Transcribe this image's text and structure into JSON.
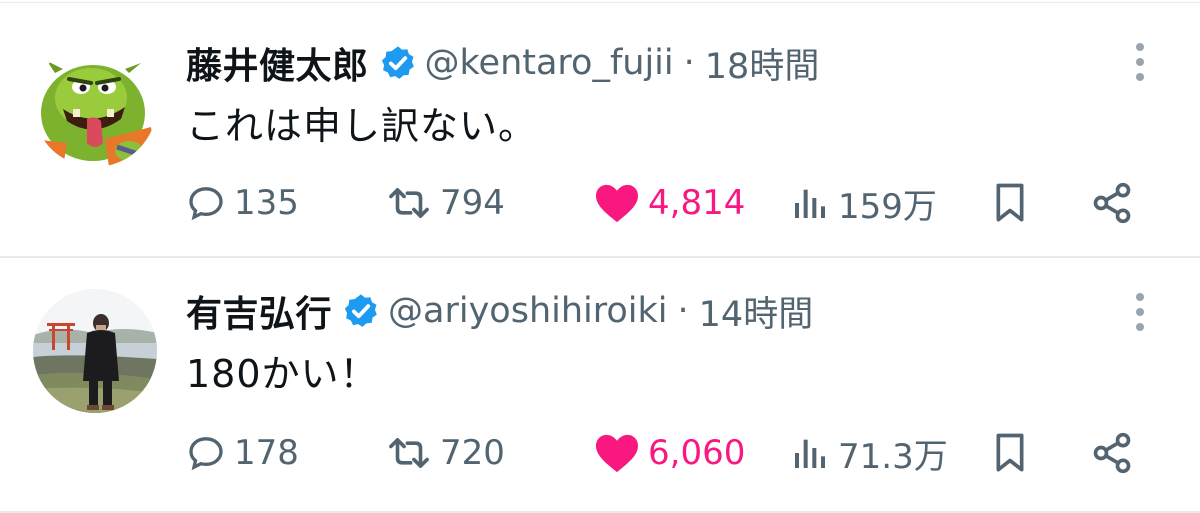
{
  "tweets": [
    {
      "author": {
        "display_name": "藤井健太郎",
        "handle": "@kentaro_fujii",
        "verified": true,
        "avatar_icon": "green-ogre-cartoon-avatar"
      },
      "separator": "·",
      "time": "18時間",
      "text": "これは申し訳ない。",
      "stats": {
        "replies": "135",
        "retweets": "794",
        "likes": "4,814",
        "views": "159万"
      },
      "liked": true
    },
    {
      "author": {
        "display_name": "有吉弘行",
        "handle": "@ariyoshihiroiki",
        "verified": true,
        "avatar_icon": "person-at-seaside-torii-avatar"
      },
      "separator": "·",
      "time": "14時間",
      "text": "180かい！",
      "stats": {
        "replies": "178",
        "retweets": "720",
        "likes": "6,060",
        "views": "71.3万"
      },
      "liked": true
    }
  ],
  "colors": {
    "verified_blue": "#1d9bf0",
    "like_pink": "#f91880",
    "secondary_text": "#536471",
    "primary_text": "#0f1419",
    "divider": "#e7ebee"
  },
  "icons": {
    "reply": "speech-bubble-icon",
    "retweet": "retweet-arrows-icon",
    "like": "heart-icon",
    "views": "bar-chart-icon",
    "bookmark": "bookmark-icon",
    "share": "share-nodes-icon",
    "more": "vertical-ellipsis-icon"
  }
}
